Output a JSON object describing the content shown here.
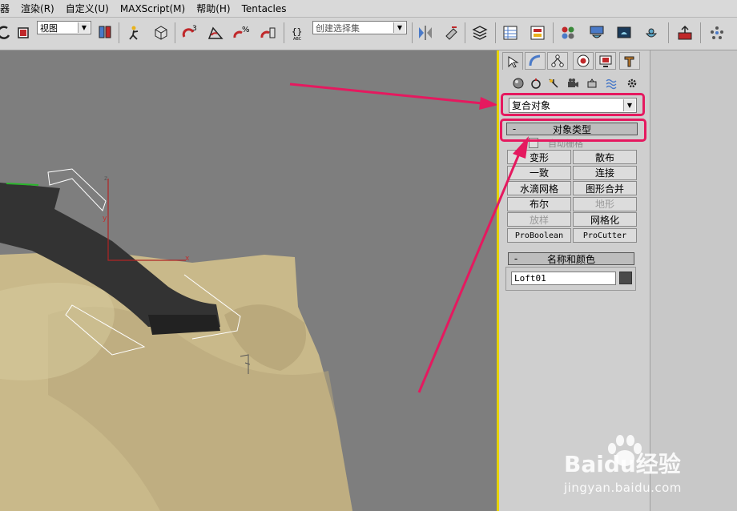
{
  "menu": [
    "器",
    "渲染(R)",
    "自定义(U)",
    "MAXScript(M)",
    "帮助(H)",
    "Tentacles"
  ],
  "toolbar": {
    "view_combo": "视图",
    "selection_set_placeholder": "创建选择集",
    "snap_label": "3",
    "percent_label": "%"
  },
  "viewport": {
    "axis_x": "x",
    "axis_y": "y",
    "axis_z": "z"
  },
  "command_panel": {
    "tabs": [
      "create-icon",
      "modify-icon",
      "hierarchy-icon",
      "motion-icon",
      "display-icon",
      "utilities-icon"
    ],
    "category_dropdown": "复合对象",
    "object_type": {
      "title": "对象类型",
      "collapse": "-",
      "autogrid": "自动栅格",
      "buttons": [
        {
          "label": "变形",
          "enabled": true
        },
        {
          "label": "散布",
          "enabled": true
        },
        {
          "label": "一致",
          "enabled": true
        },
        {
          "label": "连接",
          "enabled": true
        },
        {
          "label": "水滴网格",
          "enabled": true
        },
        {
          "label": "图形合并",
          "enabled": true
        },
        {
          "label": "布尔",
          "enabled": true
        },
        {
          "label": "地形",
          "enabled": false
        },
        {
          "label": "放样",
          "enabled": false
        },
        {
          "label": "网格化",
          "enabled": true
        },
        {
          "label": "ProBoolean",
          "enabled": true
        },
        {
          "label": "ProCutter",
          "enabled": true
        }
      ]
    },
    "name_color": {
      "title": "名称和颜色",
      "collapse": "-",
      "name_value": "Loft01",
      "swatch_color": "#4a4a4a"
    }
  },
  "watermark": {
    "brand": "Baidu经验",
    "url": "jingyan.baidu.com"
  },
  "colors": {
    "annotation": "#e5195f",
    "viewport_border": "#e7d400",
    "terrain": "#c9b98a"
  }
}
